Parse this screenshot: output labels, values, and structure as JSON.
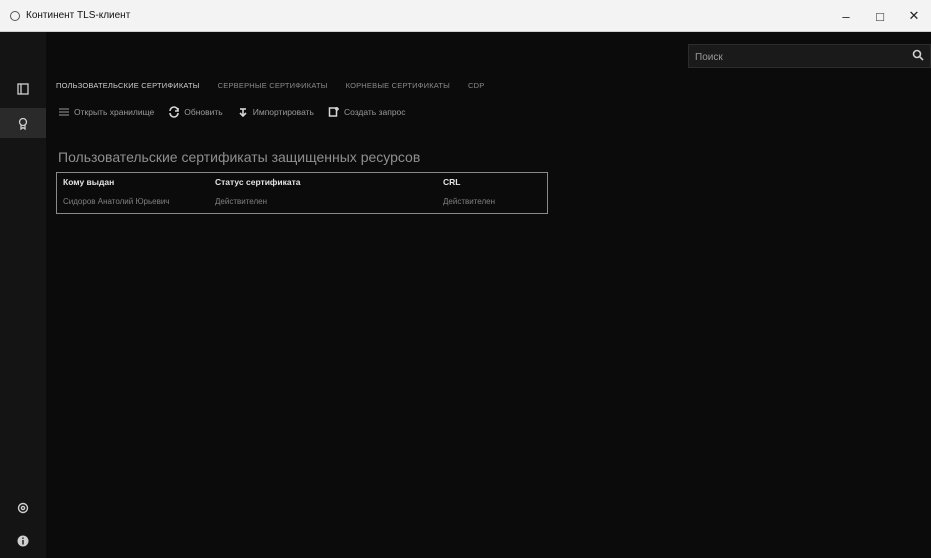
{
  "window": {
    "title": "Континент TLS-клиент",
    "controls": [
      "–",
      "□",
      "✕"
    ]
  },
  "rail": {
    "items": [
      {
        "icon": "resources-icon"
      },
      {
        "icon": "certificates-icon",
        "active": true
      }
    ],
    "bottom": [
      {
        "icon": "settings-icon"
      },
      {
        "icon": "info-icon"
      }
    ]
  },
  "search": {
    "placeholder": "Поиск"
  },
  "tabs": [
    {
      "label": "ПОЛЬЗОВАТЕЛЬСКИЕ СЕРТИФИКАТЫ",
      "active": true
    },
    {
      "label": "СЕРВЕРНЫЕ СЕРТИФИКАТЫ",
      "active": false
    },
    {
      "label": "КОРНЕВЫЕ СЕРТИФИКАТЫ",
      "active": false
    },
    {
      "label": "CDP",
      "active": false
    }
  ],
  "toolbar": {
    "open_store": "Открыть хранилище",
    "refresh": "Обновить",
    "import": "Импортировать",
    "create_request": "Создать запрос"
  },
  "section_title": "Пользовательские сертификаты защищенных ресурсов",
  "table": {
    "columns": [
      "Кому выдан",
      "Статус сертификата",
      "CRL"
    ],
    "rows": [
      [
        "Сидоров Анатолий Юрьевич",
        "Действителен",
        "Действителен"
      ]
    ]
  },
  "colors": {
    "background": "#0b0b0b",
    "titlebar": "#f3f3f3",
    "accent": "#cfcfcf"
  }
}
